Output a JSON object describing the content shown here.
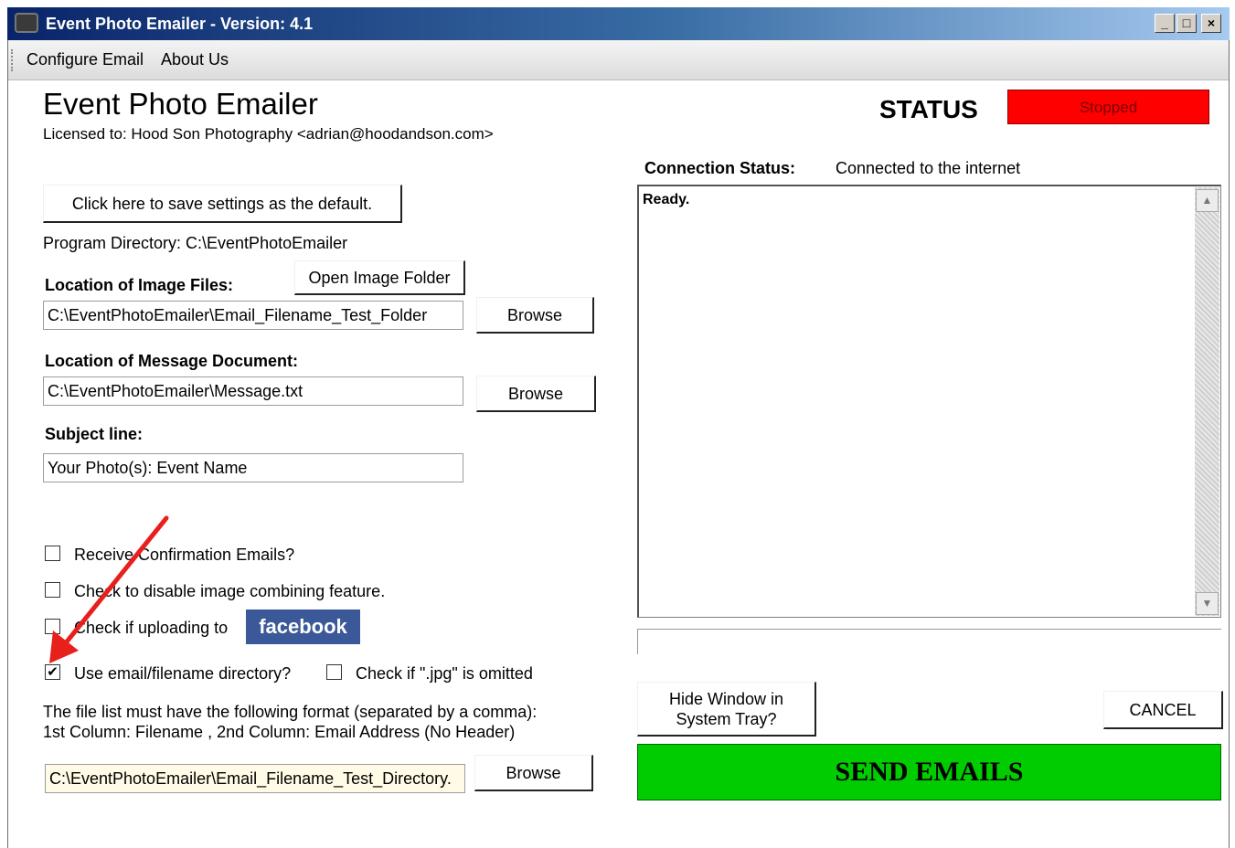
{
  "window": {
    "title": "Event Photo Emailer - Version: 4.1",
    "controls": {
      "minimize": "_",
      "maximize": "□",
      "close": "×"
    }
  },
  "menu": {
    "items": [
      {
        "label": "Configure Email"
      },
      {
        "label": "About Us"
      }
    ]
  },
  "header": {
    "app_title": "Event Photo Emailer",
    "licensed_to": "Licensed to: Hood  Son Photography   <adrian@hoodandson.com>",
    "status_label": "STATUS",
    "status_value": "Stopped"
  },
  "settings": {
    "save_default_button": "Click here to save settings as the default.",
    "program_directory": "Program Directory:  C:\\EventPhotoEmailer",
    "image_files_label": "Location of Image Files:",
    "open_image_folder_button": "Open Image Folder",
    "image_files_value": "C:\\EventPhotoEmailer\\Email_Filename_Test_Folder",
    "image_browse_button": "Browse",
    "message_doc_label": "Location of Message Document:",
    "message_doc_value": "C:\\EventPhotoEmailer\\Message.txt",
    "message_browse_button": "Browse",
    "subject_label": "Subject line:",
    "subject_value": "Your Photo(s): Event Name"
  },
  "options": {
    "confirmation_emails": {
      "label": "Receive Confirmation Emails?",
      "checked": false
    },
    "disable_combining": {
      "label": "Check to disable image combining feature.",
      "checked": false
    },
    "facebook_upload": {
      "label": "Check if uploading to",
      "checked": false,
      "logo_text": "facebook"
    },
    "use_directory": {
      "label": "Use email/filename directory?",
      "checked": true,
      "mark": "✔"
    },
    "jpg_omitted": {
      "label": "Check if \".jpg\" is omitted",
      "checked": false
    }
  },
  "file_list": {
    "format_line1": "The file list must have the following format (separated by a comma):",
    "format_line2": "1st Column: Filename , 2nd Column: Email Address (No Header)",
    "directory_value": "C:\\EventPhotoEmailer\\Email_Filename_Test_Directory.",
    "browse_button": "Browse"
  },
  "connection": {
    "label": "Connection Status:",
    "value": "Connected to the internet",
    "log_text": "Ready."
  },
  "actions": {
    "hide_window_button_line1": "Hide Window in",
    "hide_window_button_line2": "System Tray?",
    "cancel_button": "CANCEL",
    "send_button": "SEND EMAILS"
  },
  "colors": {
    "status_stopped": "#ff0000",
    "send_button": "#00cc00",
    "facebook_blue": "#3b5998",
    "annotation_arrow": "#e8201c"
  }
}
